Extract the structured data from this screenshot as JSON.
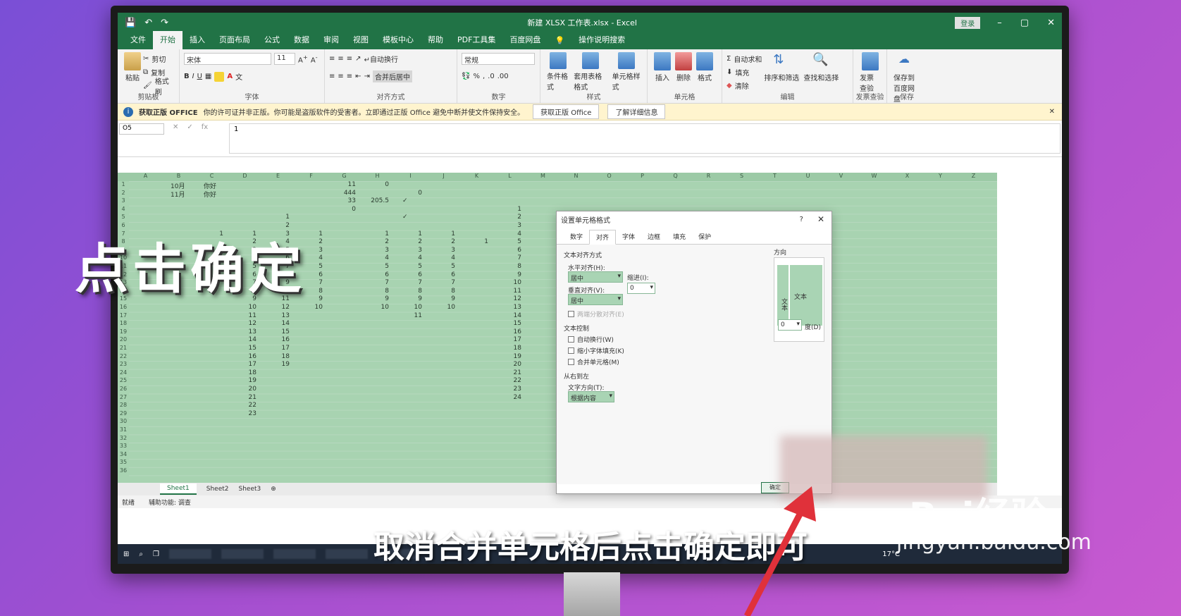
{
  "window": {
    "title": "新建 XLSX 工作表.xlsx - Excel",
    "login_label": "登录",
    "minimize": "–",
    "maximize": "▢",
    "close": "✕"
  },
  "menu_tabs": [
    "文件",
    "开始",
    "插入",
    "页面布局",
    "公式",
    "数据",
    "审阅",
    "视图",
    "模板中心",
    "帮助",
    "PDF工具集",
    "百度网盘"
  ],
  "menu_search": "操作说明搜索",
  "ribbon": {
    "clipboard": {
      "paste": "粘贴",
      "cut": "剪切",
      "copy": "复制",
      "format_painter": "格式刷",
      "label": "剪贴板"
    },
    "font": {
      "name": "宋体",
      "size": "11",
      "bold": "B",
      "italic": "I",
      "underline": "U",
      "label": "字体"
    },
    "align": {
      "wrap": "自动换行",
      "merge": "合并后居中",
      "label": "对齐方式"
    },
    "number": {
      "format": "常规",
      "label": "数字"
    },
    "styles": {
      "conditional": "条件格式",
      "table": "套用表格格式",
      "cell_style": "单元格样式",
      "label": "样式"
    },
    "cells": {
      "insert": "插入",
      "delete": "删除",
      "format": "格式",
      "label": "单元格"
    },
    "editing": {
      "autosum": "自动求和",
      "fill": "填充",
      "clear": "清除",
      "sort": "排序和筛选",
      "find": "查找和选择",
      "label": "编辑"
    },
    "invoice": {
      "check": "发票查验",
      "label": "发票查验"
    },
    "save": {
      "baidu": "保存到百度网盘",
      "label": "保存"
    }
  },
  "warning": {
    "title": "获取正版 OFFICE",
    "message": "你的许可证并非正版。你可能是盗版软件的受害者。立即通过正版 Office 避免中断并使文件保持安全。",
    "button1": "获取正版 Office",
    "button2": "了解详细信息"
  },
  "formula_bar": {
    "name_box": "O5",
    "value": "1"
  },
  "columns": [
    "A",
    "B",
    "C",
    "D",
    "E",
    "F",
    "G",
    "H",
    "I",
    "J",
    "K",
    "L",
    "M",
    "N",
    "O",
    "P",
    "Q",
    "R",
    "S",
    "T",
    "U",
    "V",
    "W",
    "X",
    "Y",
    "Z"
  ],
  "rows": [
    "1",
    "2",
    "3",
    "4",
    "5",
    "6",
    "7",
    "8",
    "9",
    "10",
    "11",
    "12",
    "13",
    "14",
    "15",
    "16",
    "17",
    "18",
    "19",
    "20",
    "21",
    "22",
    "23",
    "24",
    "25",
    "26",
    "27",
    "28",
    "29",
    "30",
    "31",
    "32",
    "33",
    "34",
    "35",
    "36"
  ],
  "cells": [
    {
      "c": 1,
      "r": 0,
      "v": "10月",
      "l": true
    },
    {
      "c": 2,
      "r": 0,
      "v": "你好",
      "l": true
    },
    {
      "c": 6,
      "r": 0,
      "v": "11"
    },
    {
      "c": 7,
      "r": 0,
      "v": "0"
    },
    {
      "c": 1,
      "r": 1,
      "v": "11月",
      "l": true
    },
    {
      "c": 2,
      "r": 1,
      "v": "你好",
      "l": true
    },
    {
      "c": 6,
      "r": 1,
      "v": "444"
    },
    {
      "c": 8,
      "r": 1,
      "v": "0"
    },
    {
      "c": 6,
      "r": 2,
      "v": "33"
    },
    {
      "c": 7,
      "r": 2,
      "v": "205.5"
    },
    {
      "c": 8,
      "r": 2,
      "v": "✓",
      "l": true
    },
    {
      "c": 6,
      "r": 3,
      "v": "0"
    },
    {
      "c": 11,
      "r": 3,
      "v": "1"
    },
    {
      "c": 4,
      "r": 4,
      "v": "1"
    },
    {
      "c": 8,
      "r": 4,
      "v": "✓",
      "l": true
    },
    {
      "c": 11,
      "r": 4,
      "v": "2"
    },
    {
      "c": 4,
      "r": 5,
      "v": "2"
    },
    {
      "c": 11,
      "r": 5,
      "v": "3"
    },
    {
      "c": 2,
      "r": 6,
      "v": "1"
    },
    {
      "c": 3,
      "r": 6,
      "v": "1"
    },
    {
      "c": 4,
      "r": 6,
      "v": "3"
    },
    {
      "c": 5,
      "r": 6,
      "v": "1"
    },
    {
      "c": 7,
      "r": 6,
      "v": "1"
    },
    {
      "c": 8,
      "r": 6,
      "v": "1"
    },
    {
      "c": 9,
      "r": 6,
      "v": "1"
    },
    {
      "c": 11,
      "r": 6,
      "v": "4"
    },
    {
      "c": 3,
      "r": 7,
      "v": "2"
    },
    {
      "c": 4,
      "r": 7,
      "v": "4"
    },
    {
      "c": 5,
      "r": 7,
      "v": "2"
    },
    {
      "c": 7,
      "r": 7,
      "v": "2"
    },
    {
      "c": 8,
      "r": 7,
      "v": "2"
    },
    {
      "c": 9,
      "r": 7,
      "v": "2"
    },
    {
      "c": 10,
      "r": 7,
      "v": "1"
    },
    {
      "c": 11,
      "r": 7,
      "v": "5"
    },
    {
      "c": 3,
      "r": 8,
      "v": "3"
    },
    {
      "c": 4,
      "r": 8,
      "v": "5"
    },
    {
      "c": 5,
      "r": 8,
      "v": "3"
    },
    {
      "c": 7,
      "r": 8,
      "v": "3"
    },
    {
      "c": 8,
      "r": 8,
      "v": "3"
    },
    {
      "c": 9,
      "r": 8,
      "v": "3"
    },
    {
      "c": 11,
      "r": 8,
      "v": "6"
    },
    {
      "c": 3,
      "r": 9,
      "v": "4"
    },
    {
      "c": 4,
      "r": 9,
      "v": "6"
    },
    {
      "c": 5,
      "r": 9,
      "v": "4"
    },
    {
      "c": 7,
      "r": 9,
      "v": "4"
    },
    {
      "c": 8,
      "r": 9,
      "v": "4"
    },
    {
      "c": 9,
      "r": 9,
      "v": "4"
    },
    {
      "c": 11,
      "r": 9,
      "v": "7"
    },
    {
      "c": 3,
      "r": 10,
      "v": "5"
    },
    {
      "c": 4,
      "r": 10,
      "v": "7"
    },
    {
      "c": 5,
      "r": 10,
      "v": "5"
    },
    {
      "c": 7,
      "r": 10,
      "v": "5"
    },
    {
      "c": 8,
      "r": 10,
      "v": "5"
    },
    {
      "c": 9,
      "r": 10,
      "v": "5"
    },
    {
      "c": 11,
      "r": 10,
      "v": "8"
    },
    {
      "c": 3,
      "r": 11,
      "v": "6"
    },
    {
      "c": 4,
      "r": 11,
      "v": "8"
    },
    {
      "c": 5,
      "r": 11,
      "v": "6"
    },
    {
      "c": 7,
      "r": 11,
      "v": "6"
    },
    {
      "c": 8,
      "r": 11,
      "v": "6"
    },
    {
      "c": 9,
      "r": 11,
      "v": "6"
    },
    {
      "c": 11,
      "r": 11,
      "v": "9"
    },
    {
      "c": 3,
      "r": 12,
      "v": "7"
    },
    {
      "c": 4,
      "r": 12,
      "v": "9"
    },
    {
      "c": 5,
      "r": 12,
      "v": "7"
    },
    {
      "c": 7,
      "r": 12,
      "v": "7"
    },
    {
      "c": 8,
      "r": 12,
      "v": "7"
    },
    {
      "c": 9,
      "r": 12,
      "v": "7"
    },
    {
      "c": 11,
      "r": 12,
      "v": "10"
    },
    {
      "c": 3,
      "r": 13,
      "v": "8"
    },
    {
      "c": 4,
      "r": 13,
      "v": "10"
    },
    {
      "c": 5,
      "r": 13,
      "v": "8"
    },
    {
      "c": 7,
      "r": 13,
      "v": "8"
    },
    {
      "c": 8,
      "r": 13,
      "v": "8"
    },
    {
      "c": 9,
      "r": 13,
      "v": "8"
    },
    {
      "c": 11,
      "r": 13,
      "v": "11"
    },
    {
      "c": 3,
      "r": 14,
      "v": "9"
    },
    {
      "c": 4,
      "r": 14,
      "v": "11"
    },
    {
      "c": 5,
      "r": 14,
      "v": "9"
    },
    {
      "c": 7,
      "r": 14,
      "v": "9"
    },
    {
      "c": 8,
      "r": 14,
      "v": "9"
    },
    {
      "c": 9,
      "r": 14,
      "v": "9"
    },
    {
      "c": 11,
      "r": 14,
      "v": "12"
    },
    {
      "c": 3,
      "r": 15,
      "v": "10"
    },
    {
      "c": 4,
      "r": 15,
      "v": "12"
    },
    {
      "c": 5,
      "r": 15,
      "v": "10"
    },
    {
      "c": 7,
      "r": 15,
      "v": "10"
    },
    {
      "c": 8,
      "r": 15,
      "v": "10"
    },
    {
      "c": 9,
      "r": 15,
      "v": "10"
    },
    {
      "c": 11,
      "r": 15,
      "v": "13"
    },
    {
      "c": 3,
      "r": 16,
      "v": "11"
    },
    {
      "c": 4,
      "r": 16,
      "v": "13"
    },
    {
      "c": 8,
      "r": 16,
      "v": "11"
    },
    {
      "c": 11,
      "r": 16,
      "v": "14"
    },
    {
      "c": 3,
      "r": 17,
      "v": "12"
    },
    {
      "c": 4,
      "r": 17,
      "v": "14"
    },
    {
      "c": 11,
      "r": 17,
      "v": "15"
    },
    {
      "c": 3,
      "r": 18,
      "v": "13"
    },
    {
      "c": 4,
      "r": 18,
      "v": "15"
    },
    {
      "c": 11,
      "r": 18,
      "v": "16"
    },
    {
      "c": 3,
      "r": 19,
      "v": "14"
    },
    {
      "c": 4,
      "r": 19,
      "v": "16"
    },
    {
      "c": 11,
      "r": 19,
      "v": "17"
    },
    {
      "c": 3,
      "r": 20,
      "v": "15"
    },
    {
      "c": 4,
      "r": 20,
      "v": "17"
    },
    {
      "c": 11,
      "r": 20,
      "v": "18"
    },
    {
      "c": 3,
      "r": 21,
      "v": "16"
    },
    {
      "c": 4,
      "r": 21,
      "v": "18"
    },
    {
      "c": 11,
      "r": 21,
      "v": "19"
    },
    {
      "c": 3,
      "r": 22,
      "v": "17"
    },
    {
      "c": 4,
      "r": 22,
      "v": "19"
    },
    {
      "c": 11,
      "r": 22,
      "v": "20"
    },
    {
      "c": 3,
      "r": 23,
      "v": "18"
    },
    {
      "c": 11,
      "r": 23,
      "v": "21"
    },
    {
      "c": 3,
      "r": 24,
      "v": "19"
    },
    {
      "c": 11,
      "r": 24,
      "v": "22"
    },
    {
      "c": 3,
      "r": 25,
      "v": "20"
    },
    {
      "c": 11,
      "r": 25,
      "v": "23"
    },
    {
      "c": 3,
      "r": 26,
      "v": "21"
    },
    {
      "c": 11,
      "r": 26,
      "v": "24"
    },
    {
      "c": 3,
      "r": 27,
      "v": "22"
    },
    {
      "c": 3,
      "r": 28,
      "v": "23"
    }
  ],
  "sheet_tabs": [
    "Sheet1",
    "Sheet2",
    "Sheet3"
  ],
  "status": {
    "ready": "就绪",
    "accessibility": "辅助功能: 调查"
  },
  "taskbar": {
    "weather": "17°C"
  },
  "dialog": {
    "title": "设置单元格格式",
    "help": "?",
    "close": "✕",
    "tabs": [
      "数字",
      "对齐",
      "字体",
      "边框",
      "填充",
      "保护"
    ],
    "text_align_section": "文本对齐方式",
    "horizontal_label": "水平对齐(H):",
    "horizontal_value": "居中",
    "indent_label": "缩进(I):",
    "indent_value": "0",
    "vertical_label": "垂直对齐(V):",
    "vertical_value": "居中",
    "justify_distributed": "两端分散对齐(E)",
    "text_control_section": "文本控制",
    "wrap_text": "自动换行(W)",
    "shrink_to_fit": "缩小字体填充(K)",
    "merge_cells": "合并单元格(M)",
    "rtl_section": "从右到左",
    "text_direction_label": "文字方向(T):",
    "text_direction_value": "根据内容",
    "orientation_label": "方向",
    "orientation_vertical": "文本",
    "orientation_text": "文本",
    "degrees_value": "0",
    "degrees_label": "度(D)",
    "ok": "确定"
  },
  "overlay": {
    "big_caption": "点击确定",
    "subtitle": "取消合并单元格后点击确定即可",
    "watermark_brand": "Bai经验",
    "watermark_url": "jingyan.baidu.com"
  }
}
